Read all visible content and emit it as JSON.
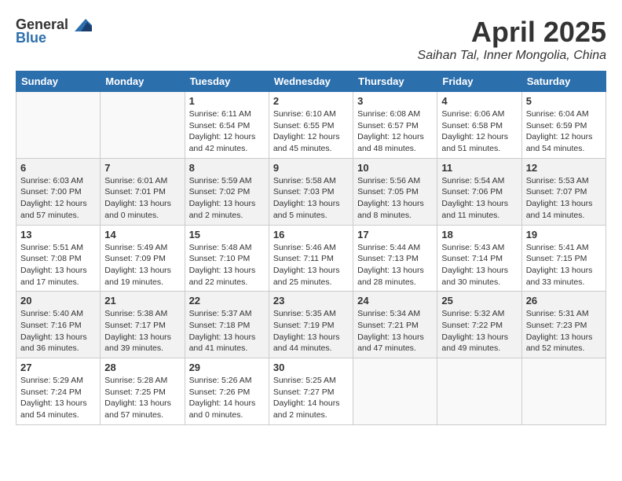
{
  "header": {
    "logo_general": "General",
    "logo_blue": "Blue",
    "month_title": "April 2025",
    "location": "Saihan Tal, Inner Mongolia, China"
  },
  "weekdays": [
    "Sunday",
    "Monday",
    "Tuesday",
    "Wednesday",
    "Thursday",
    "Friday",
    "Saturday"
  ],
  "weeks": [
    [
      {
        "day": "",
        "info": ""
      },
      {
        "day": "",
        "info": ""
      },
      {
        "day": "1",
        "info": "Sunrise: 6:11 AM\nSunset: 6:54 PM\nDaylight: 12 hours\nand 42 minutes."
      },
      {
        "day": "2",
        "info": "Sunrise: 6:10 AM\nSunset: 6:55 PM\nDaylight: 12 hours\nand 45 minutes."
      },
      {
        "day": "3",
        "info": "Sunrise: 6:08 AM\nSunset: 6:57 PM\nDaylight: 12 hours\nand 48 minutes."
      },
      {
        "day": "4",
        "info": "Sunrise: 6:06 AM\nSunset: 6:58 PM\nDaylight: 12 hours\nand 51 minutes."
      },
      {
        "day": "5",
        "info": "Sunrise: 6:04 AM\nSunset: 6:59 PM\nDaylight: 12 hours\nand 54 minutes."
      }
    ],
    [
      {
        "day": "6",
        "info": "Sunrise: 6:03 AM\nSunset: 7:00 PM\nDaylight: 12 hours\nand 57 minutes."
      },
      {
        "day": "7",
        "info": "Sunrise: 6:01 AM\nSunset: 7:01 PM\nDaylight: 13 hours\nand 0 minutes."
      },
      {
        "day": "8",
        "info": "Sunrise: 5:59 AM\nSunset: 7:02 PM\nDaylight: 13 hours\nand 2 minutes."
      },
      {
        "day": "9",
        "info": "Sunrise: 5:58 AM\nSunset: 7:03 PM\nDaylight: 13 hours\nand 5 minutes."
      },
      {
        "day": "10",
        "info": "Sunrise: 5:56 AM\nSunset: 7:05 PM\nDaylight: 13 hours\nand 8 minutes."
      },
      {
        "day": "11",
        "info": "Sunrise: 5:54 AM\nSunset: 7:06 PM\nDaylight: 13 hours\nand 11 minutes."
      },
      {
        "day": "12",
        "info": "Sunrise: 5:53 AM\nSunset: 7:07 PM\nDaylight: 13 hours\nand 14 minutes."
      }
    ],
    [
      {
        "day": "13",
        "info": "Sunrise: 5:51 AM\nSunset: 7:08 PM\nDaylight: 13 hours\nand 17 minutes."
      },
      {
        "day": "14",
        "info": "Sunrise: 5:49 AM\nSunset: 7:09 PM\nDaylight: 13 hours\nand 19 minutes."
      },
      {
        "day": "15",
        "info": "Sunrise: 5:48 AM\nSunset: 7:10 PM\nDaylight: 13 hours\nand 22 minutes."
      },
      {
        "day": "16",
        "info": "Sunrise: 5:46 AM\nSunset: 7:11 PM\nDaylight: 13 hours\nand 25 minutes."
      },
      {
        "day": "17",
        "info": "Sunrise: 5:44 AM\nSunset: 7:13 PM\nDaylight: 13 hours\nand 28 minutes."
      },
      {
        "day": "18",
        "info": "Sunrise: 5:43 AM\nSunset: 7:14 PM\nDaylight: 13 hours\nand 30 minutes."
      },
      {
        "day": "19",
        "info": "Sunrise: 5:41 AM\nSunset: 7:15 PM\nDaylight: 13 hours\nand 33 minutes."
      }
    ],
    [
      {
        "day": "20",
        "info": "Sunrise: 5:40 AM\nSunset: 7:16 PM\nDaylight: 13 hours\nand 36 minutes."
      },
      {
        "day": "21",
        "info": "Sunrise: 5:38 AM\nSunset: 7:17 PM\nDaylight: 13 hours\nand 39 minutes."
      },
      {
        "day": "22",
        "info": "Sunrise: 5:37 AM\nSunset: 7:18 PM\nDaylight: 13 hours\nand 41 minutes."
      },
      {
        "day": "23",
        "info": "Sunrise: 5:35 AM\nSunset: 7:19 PM\nDaylight: 13 hours\nand 44 minutes."
      },
      {
        "day": "24",
        "info": "Sunrise: 5:34 AM\nSunset: 7:21 PM\nDaylight: 13 hours\nand 47 minutes."
      },
      {
        "day": "25",
        "info": "Sunrise: 5:32 AM\nSunset: 7:22 PM\nDaylight: 13 hours\nand 49 minutes."
      },
      {
        "day": "26",
        "info": "Sunrise: 5:31 AM\nSunset: 7:23 PM\nDaylight: 13 hours\nand 52 minutes."
      }
    ],
    [
      {
        "day": "27",
        "info": "Sunrise: 5:29 AM\nSunset: 7:24 PM\nDaylight: 13 hours\nand 54 minutes."
      },
      {
        "day": "28",
        "info": "Sunrise: 5:28 AM\nSunset: 7:25 PM\nDaylight: 13 hours\nand 57 minutes."
      },
      {
        "day": "29",
        "info": "Sunrise: 5:26 AM\nSunset: 7:26 PM\nDaylight: 14 hours\nand 0 minutes."
      },
      {
        "day": "30",
        "info": "Sunrise: 5:25 AM\nSunset: 7:27 PM\nDaylight: 14 hours\nand 2 minutes."
      },
      {
        "day": "",
        "info": ""
      },
      {
        "day": "",
        "info": ""
      },
      {
        "day": "",
        "info": ""
      }
    ]
  ]
}
